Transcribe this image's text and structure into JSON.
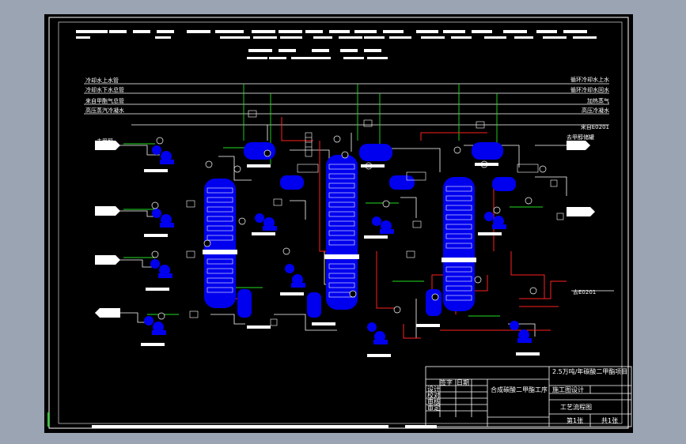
{
  "utility_lines_left": [
    "冷却水上水管",
    "冷却水下水总管",
    "来自甲酯气总管",
    "高压蒸汽冷凝水"
  ],
  "utility_lines_right": [
    "循环冷却水上水",
    "循环冷却水回水",
    "加热蒸气",
    "高压冷凝水",
    "来自E0201"
  ],
  "inlets": [
    "去甲醇"
  ],
  "outlets": [
    "去甲醇储罐",
    "去E0201"
  ],
  "title_block": {
    "project": "2.5万吨/年碳酸二甲酯项目",
    "drawing_title": "合成碳酸二甲酯工序",
    "drawing_name": "工艺流程图",
    "stage": "施工图设计",
    "roles": [
      "设计",
      "校对",
      "审核",
      "审定"
    ],
    "sheet": "第1张",
    "total": "共1张",
    "col_headers": [
      "签字",
      "日期"
    ]
  },
  "colors": {
    "equipment": "#0000ff",
    "process_line": "#ff2020",
    "steam_line": "#22dd22",
    "frame": "#ffffff"
  }
}
